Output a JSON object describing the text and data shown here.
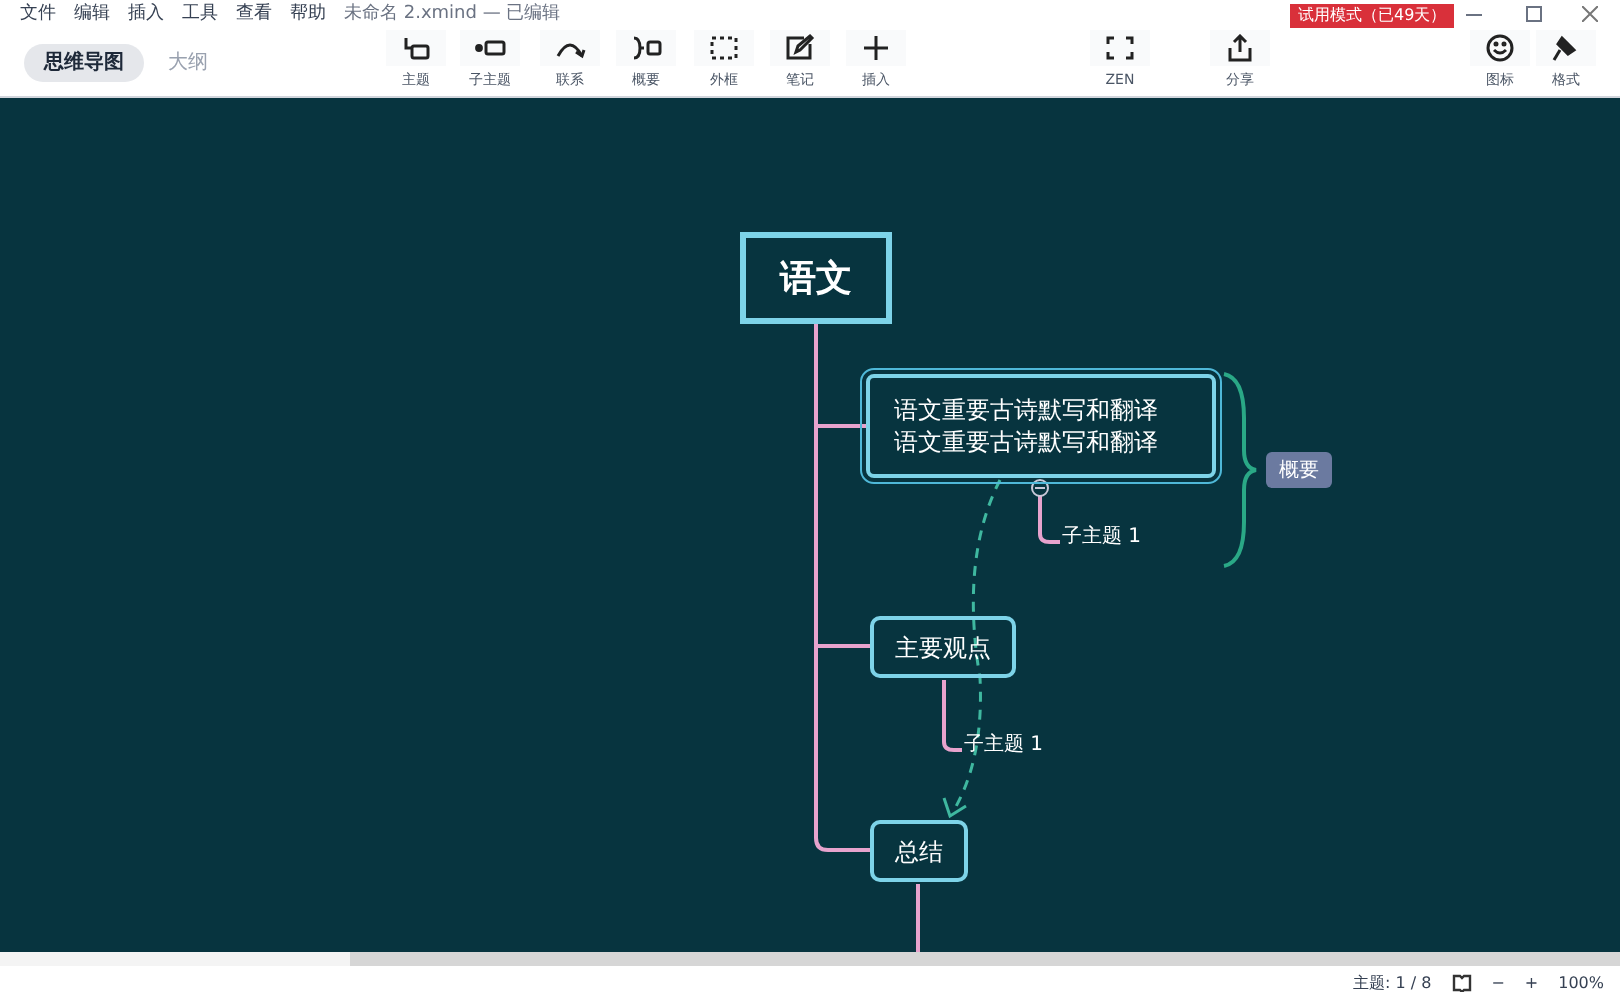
{
  "menu": [
    "文件",
    "编辑",
    "插入",
    "工具",
    "查看",
    "帮助"
  ],
  "window": {
    "title": "未命名 2.xmind — 已编辑",
    "trial_badge": "试用模式（已49天）"
  },
  "view_tabs": [
    {
      "label": "思维导图",
      "selected": true
    },
    {
      "label": "大纲",
      "selected": false
    }
  ],
  "toolbar": [
    {
      "kind": "topic",
      "label": "主题"
    },
    {
      "kind": "subtopic",
      "label": "子主题"
    },
    {
      "kind": "relation",
      "label": "联系"
    },
    {
      "kind": "summary",
      "label": "概要"
    },
    {
      "kind": "boundary",
      "label": "外框"
    },
    {
      "kind": "note",
      "label": "笔记"
    },
    {
      "kind": "insert",
      "label": "插入"
    },
    {
      "kind": "zen",
      "label": "ZEN"
    },
    {
      "kind": "share",
      "label": "分享"
    },
    {
      "kind": "icons",
      "label": "图标"
    },
    {
      "kind": "format",
      "label": "格式"
    }
  ],
  "map": {
    "central": "语文",
    "topics": [
      {
        "lines": [
          "语文重要古诗默写和翻译",
          "语文重要古诗默写和翻译"
        ],
        "selected": true,
        "subtopic": "子主题 1"
      },
      {
        "lines": [
          "主要观点"
        ],
        "selected": false,
        "subtopic": "子主题 1"
      },
      {
        "lines": [
          "总结"
        ],
        "selected": false
      }
    ],
    "summary": "概要"
  },
  "status_bar": {
    "topic_count": "主题: 1 / 8",
    "zoom_out": "−",
    "zoom_in": "+",
    "zoom": "100%"
  }
}
